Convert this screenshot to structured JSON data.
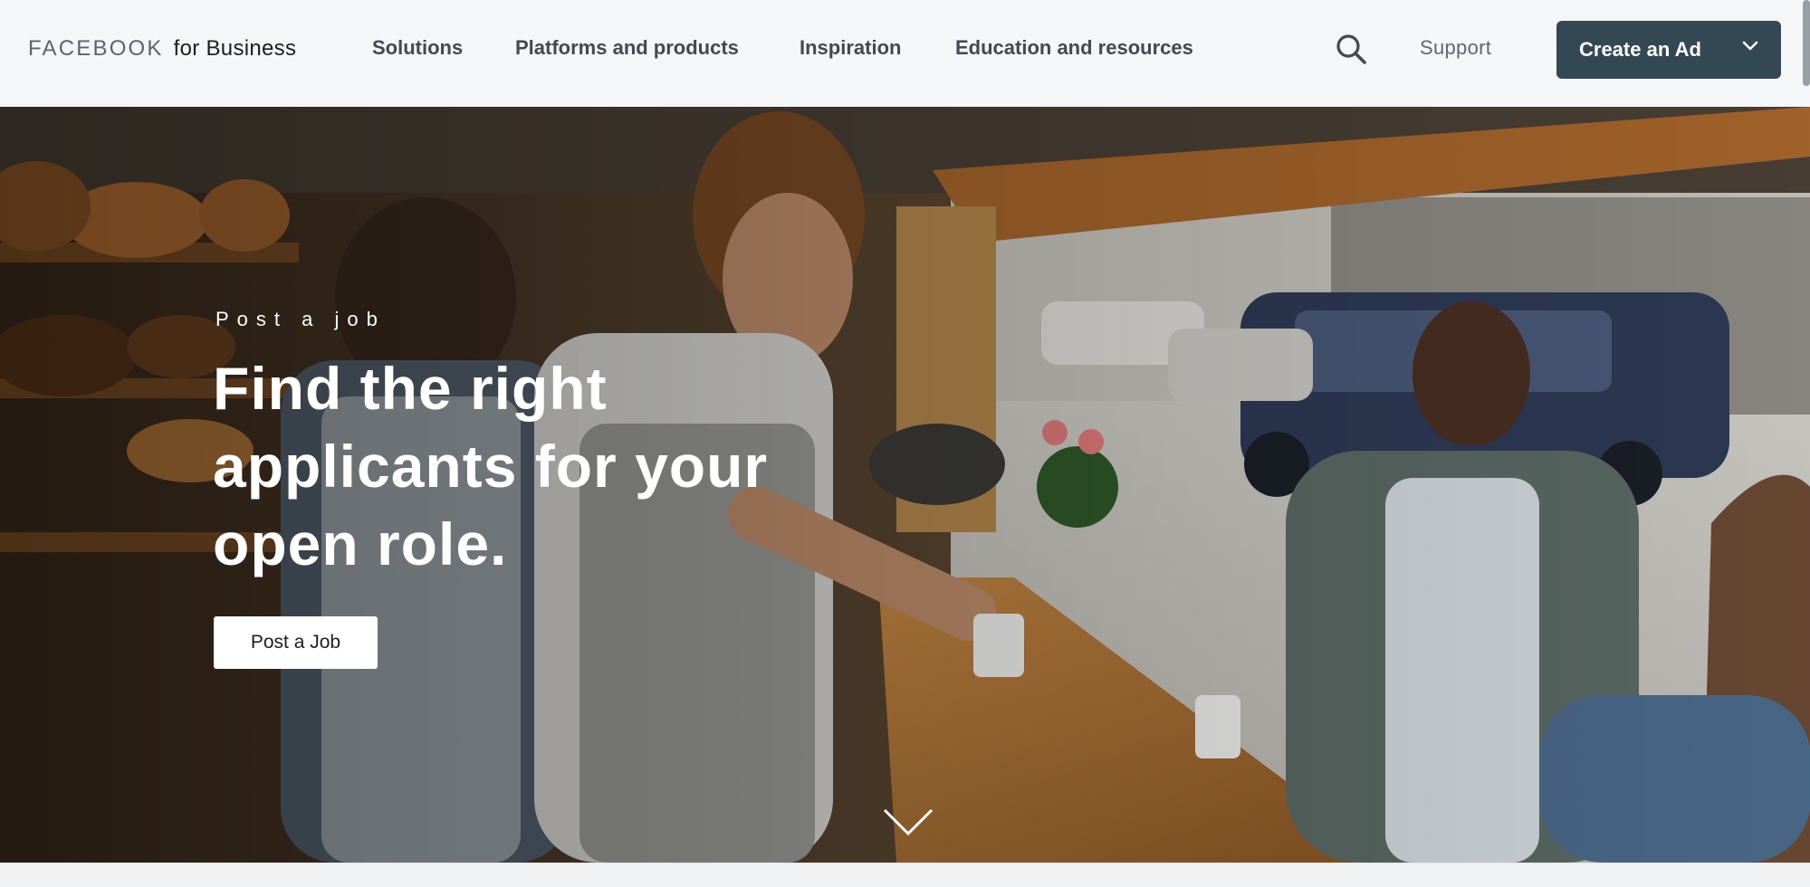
{
  "header": {
    "logo_brand": "FACEBOOK",
    "logo_suffix": "for Business",
    "nav": [
      {
        "label": "Solutions"
      },
      {
        "label": "Platforms and products"
      },
      {
        "label": "Inspiration"
      },
      {
        "label": "Education and resources"
      }
    ],
    "search_icon": "search-icon",
    "support_label": "Support",
    "create_ad_label": "Create an Ad",
    "create_ad_icon": "chevron-down-icon",
    "button_color": "#344854"
  },
  "hero": {
    "eyebrow": "Post a job",
    "headline": "Find the right applicants for your open role.",
    "cta_label": "Post a Job",
    "scroll_icon": "chevron-down-icon"
  }
}
